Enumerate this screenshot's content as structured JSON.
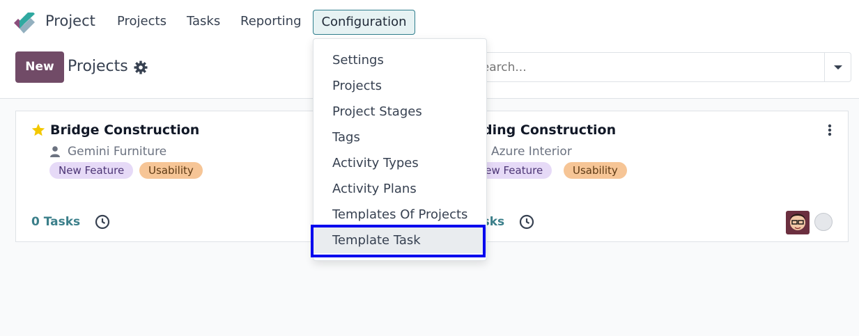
{
  "navbar": {
    "app_name": "Project",
    "menu": [
      "Projects",
      "Tasks",
      "Reporting"
    ],
    "active_menu": "Configuration"
  },
  "control_panel": {
    "new_label": "New",
    "title": "Projects",
    "search_placeholder": "Search..."
  },
  "dropdown": {
    "items": [
      "Settings",
      "Projects",
      "Project Stages",
      "Tags",
      "Activity Types",
      "Activity Plans",
      "Templates Of Projects",
      "Template Task"
    ],
    "highlighted_item": "Template Task"
  },
  "cards": [
    {
      "title": "Bridge Construction",
      "partner": "Gemini Furniture",
      "tags": [
        "New Feature",
        "Usability"
      ],
      "tasks": "0 Tasks",
      "favorite": true
    },
    {
      "title": "Building Construction",
      "partner": "Azure Interior",
      "tags": [
        "New Feature",
        "Usability"
      ],
      "tasks": "0 Tasks",
      "favorite": false
    }
  ],
  "colors": {
    "brand": "#714b67",
    "accent": "#3b7f8a",
    "highlight_border": "#0000ee",
    "star": "#f3c800"
  },
  "icons": [
    "project-logo-icon",
    "gear-icon",
    "caret-down-icon",
    "star-icon",
    "user-icon",
    "clock-icon",
    "kebab-menu-icon",
    "avatar-icon"
  ]
}
